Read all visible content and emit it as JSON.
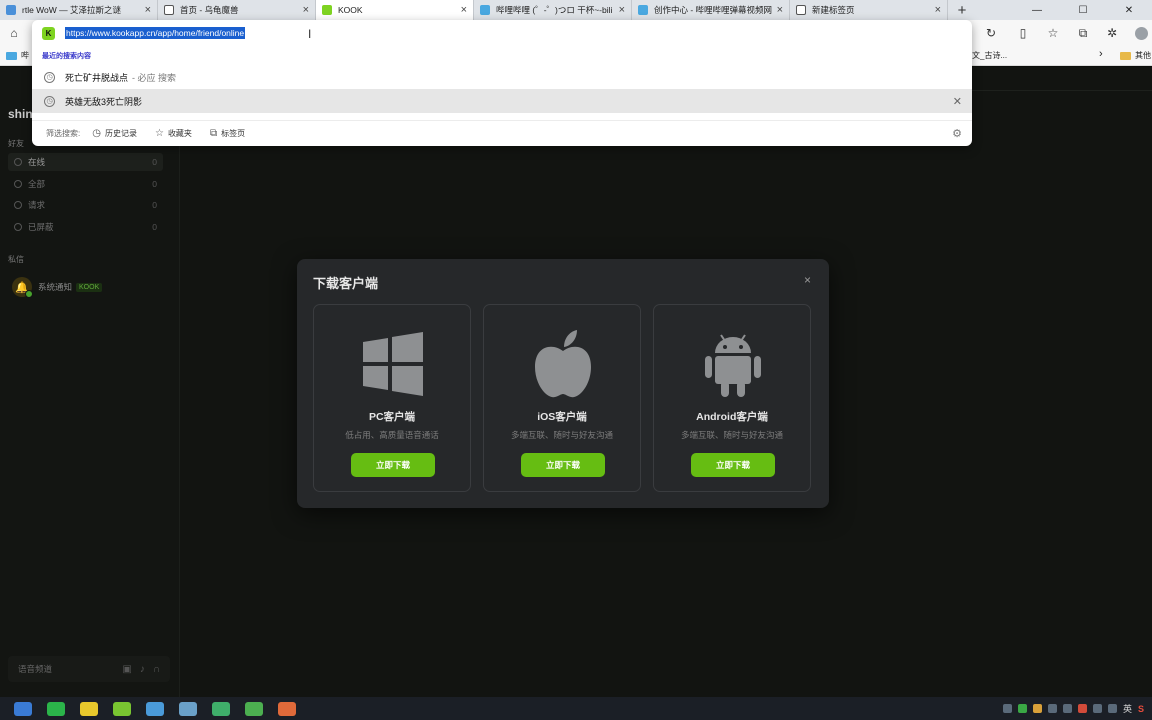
{
  "browser": {
    "tabs": [
      {
        "title": "rtle WoW — 艾泽拉斯之谜",
        "favicon_color": "#4a90d9",
        "active": false
      },
      {
        "title": "首页 - 乌龟魔兽",
        "favicon_color": "#888888",
        "active": false
      },
      {
        "title": "KOOK",
        "favicon_color": "#7ed321",
        "active": true
      },
      {
        "title": "哔哩哔哩 (゜-゜)つロ 干杯~-bili",
        "favicon_color": "#4aa8e0",
        "active": false
      },
      {
        "title": "创作中心 - 哔哩哔哩弹幕视频网",
        "favicon_color": "#4aa8e0",
        "active": false
      },
      {
        "title": "新建标签页",
        "favicon_color": "#666666",
        "active": false
      }
    ],
    "new_tab_label": "+",
    "window_controls": {
      "minimize": "—",
      "maximize": "☐",
      "close": "✕"
    },
    "bookmarks": {
      "first": "哔",
      "middle": "文_古诗...",
      "chevron": "›",
      "other": "其他"
    }
  },
  "omnibox": {
    "url": "https://www.kookapp.cn/app/home/friend/online",
    "recent_label": "最近的搜索内容",
    "suggestions": [
      {
        "text": "死亡矿井脱战点",
        "sub": "- 必应 搜索",
        "highlighted": false
      },
      {
        "text": "英雄无敌3死亡阴影",
        "sub": "",
        "highlighted": true
      }
    ],
    "remove_icon": "✕",
    "filter_label": "筛选搜索:",
    "filters": [
      {
        "icon": "history-icon",
        "label": "历史记录"
      },
      {
        "icon": "star-icon",
        "label": "收藏夹"
      },
      {
        "icon": "tabs-icon",
        "label": "标签页"
      }
    ]
  },
  "sidebar": {
    "username": "shin",
    "friends_label": "好友",
    "items": [
      {
        "label": "在线",
        "count": "0",
        "active": true
      },
      {
        "label": "全部",
        "count": "0",
        "active": false
      },
      {
        "label": "请求",
        "count": "0",
        "active": false
      },
      {
        "label": "已屏蔽",
        "count": "0",
        "active": false
      }
    ],
    "dm_label": "私信",
    "dm_entry": {
      "name": "系统通知",
      "tag": "KOOK"
    },
    "voice_label": "语音频道"
  },
  "modal": {
    "title": "下载客户端",
    "close_icon": "×",
    "cards": [
      {
        "icon": "windows-icon",
        "name": "PC客户端",
        "desc": "低占用、高质量语音通话",
        "button": "立即下载"
      },
      {
        "icon": "apple-icon",
        "name": "iOS客户端",
        "desc": "多端互联、随时与好友沟通",
        "button": "立即下载"
      },
      {
        "icon": "android-icon",
        "name": "Android客户端",
        "desc": "多端互联、随时与好友沟通",
        "button": "立即下载"
      }
    ]
  },
  "taskbar": {
    "tray_lang": "英",
    "tray_ime": "S"
  },
  "colors": {
    "accent_green": "#66bd12",
    "app_bg": "#121411",
    "modal_bg": "#26282a",
    "url_highlight": "#1a5fcf"
  }
}
